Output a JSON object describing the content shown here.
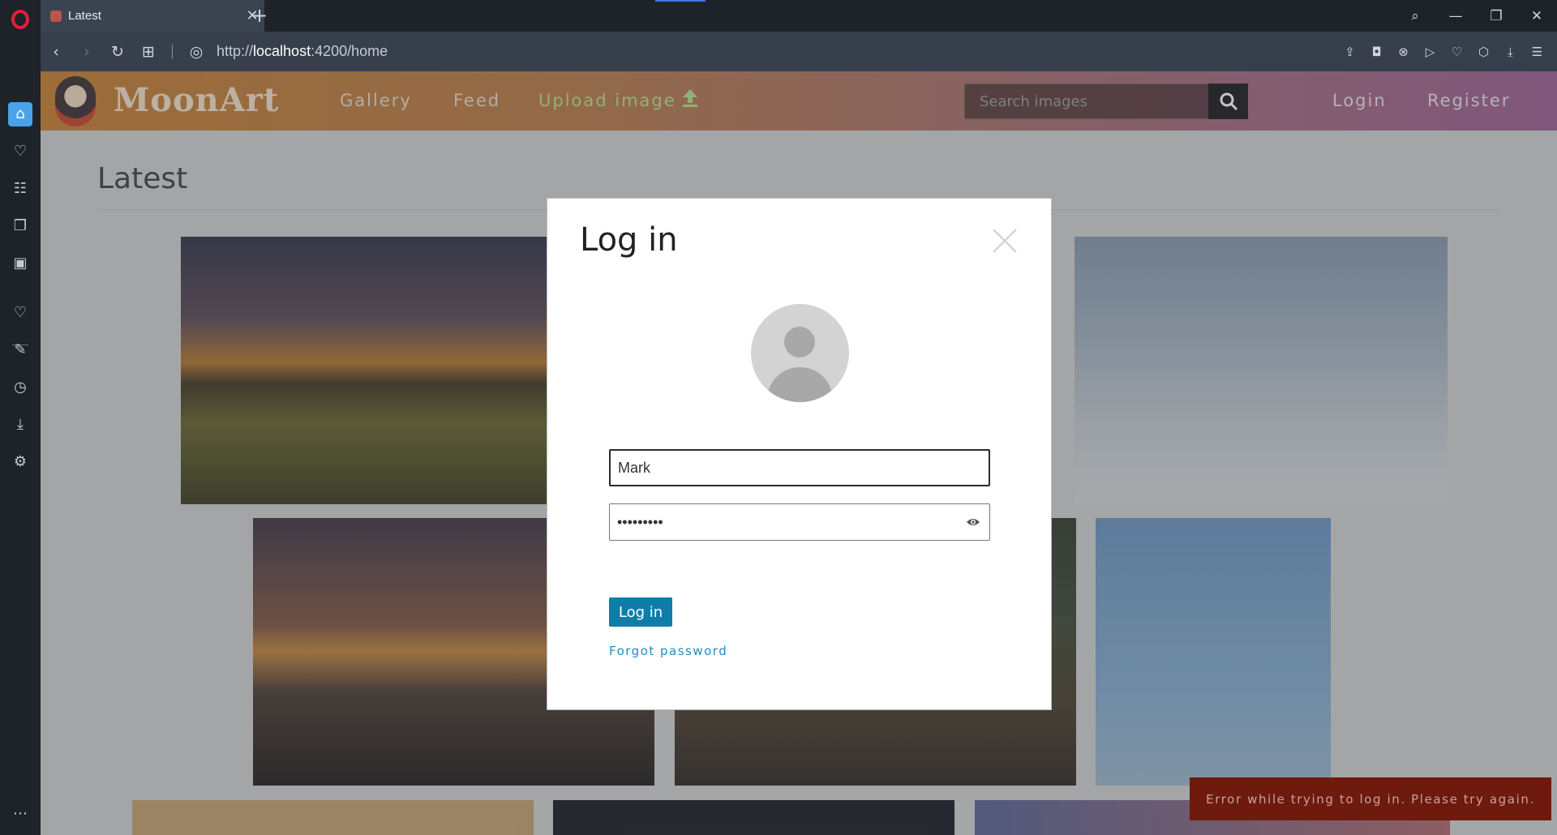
{
  "browser": {
    "tab_title": "Latest",
    "new_tab": "+",
    "tab_close": "✕",
    "url_prefix": "http://",
    "url_host": "localhost",
    "url_rest": ":4200/home"
  },
  "site": {
    "logo": "MoonArt",
    "nav": {
      "gallery": "Gallery",
      "feed": "Feed",
      "upload": "Upload image"
    },
    "search_placeholder": "Search images",
    "login": "Login",
    "register": "Register",
    "accent_upload": "#b7e08c"
  },
  "main": {
    "section_title": "Latest"
  },
  "modal": {
    "title": "Log in",
    "username_value": "Mark",
    "password_value": "•••••••••",
    "login_button": "Log in",
    "forgot_link": "Forgot password",
    "accent": "#0e7ea8"
  },
  "toast": {
    "message": "Error while trying to log in. Please try again.",
    "color": "#6e1a0c"
  }
}
